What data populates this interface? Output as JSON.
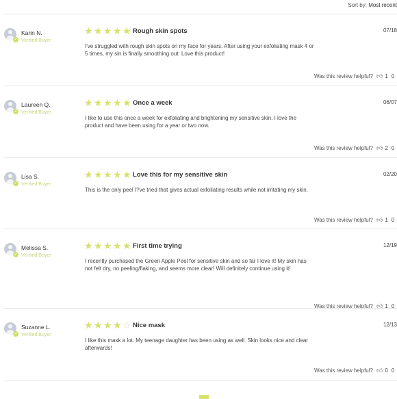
{
  "sort": {
    "label": "Sort by:",
    "value": "Most recent"
  },
  "helpful_label": "Was this review helpful?",
  "verified_label": "Verified Buyer",
  "colors": {
    "star": "#d7e16b",
    "verified": "#c8d47a",
    "accent": "#d9e36b"
  },
  "reviews": [
    {
      "name": "Karin N.",
      "rating": 5,
      "title": "Rough skin spots",
      "date": "07/18",
      "body": "I've struggled with rough skin spots on my face for years. After using your exfoliating mask 4 or 5 times, my sin is finally smoothing out. Love this product!",
      "up": "1",
      "down": "0"
    },
    {
      "name": "Laureen Q.",
      "rating": 5,
      "title": "Once a week",
      "date": "06/07",
      "body": "I like to use this once a week for exfoliating and brightening my sensitive skin. I love the product and have been using for a year or two now.",
      "up": "2",
      "down": "0"
    },
    {
      "name": "Lisa S.",
      "rating": 5,
      "title": "Love this for my sensitive skin",
      "date": "02/20",
      "body": "This is the only peel I?ve tried that gives actual exfoliating results while not irritating my skin.",
      "up": "1",
      "down": "0"
    },
    {
      "name": "Melissa S.",
      "rating": 5,
      "title": "First time trying",
      "date": "12/19",
      "body": "I recently purchased the Green Apple Peel for sensitive skin and so far I love it! My skin has not felt dry, no peeling/flaking, and seems more clear! Will definitely continue using it!",
      "up": "1",
      "down": "0"
    },
    {
      "name": "Suzanne L.",
      "rating": 4,
      "title": "Nice mask",
      "date": "12/13",
      "body": "I like this mask a lot. My teenage daughter has been using as well. Skin looks nice and clear afterwards!",
      "up": "0",
      "down": "0"
    }
  ]
}
